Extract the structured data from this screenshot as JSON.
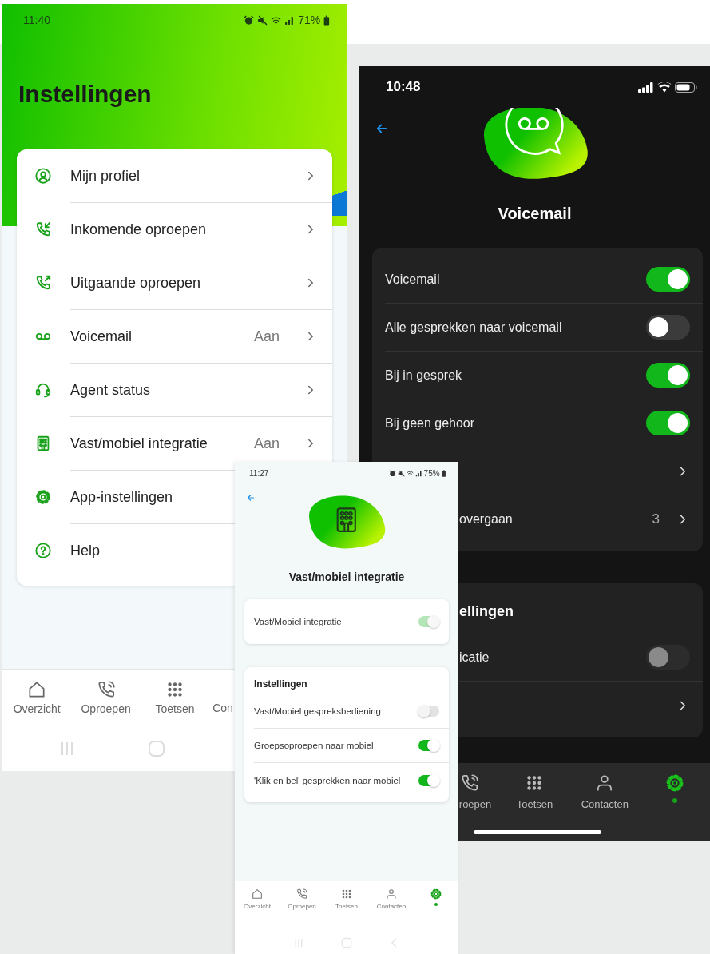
{
  "settings_screen": {
    "status_bar": {
      "time": "11:40",
      "battery": "71%"
    },
    "title": "Instellingen",
    "menu": [
      {
        "label": "Mijn profiel",
        "chevron": true
      },
      {
        "label": "Inkomende oproepen",
        "chevron": true
      },
      {
        "label": "Uitgaande oproepen",
        "chevron": true
      },
      {
        "label": "Voicemail",
        "value": "Aan",
        "chevron": true
      },
      {
        "label": "Agent status",
        "chevron": true
      },
      {
        "label": "Vast/mobiel integratie",
        "value": "Aan",
        "chevron": true
      },
      {
        "label": "App-instellingen",
        "chevron": false
      },
      {
        "label": "Help",
        "chevron": false
      }
    ],
    "nav": [
      {
        "label": "Overzicht",
        "selected": false
      },
      {
        "label": "Oproepen",
        "selected": false
      },
      {
        "label": "Toetsen",
        "selected": false
      },
      {
        "label": "Con",
        "selected": false
      }
    ]
  },
  "voicemail_screen": {
    "status_bar": {
      "time": "10:48"
    },
    "title": "Voicemail",
    "groups": [
      {
        "rows": [
          {
            "kind": "toggle",
            "label": "Voicemail",
            "on": true,
            "disabled": false
          },
          {
            "kind": "toggle",
            "label": "Alle gesprekken naar voicemail",
            "on": false,
            "disabled": false
          },
          {
            "kind": "toggle",
            "label": "Bij in gesprek",
            "on": true,
            "disabled": false
          },
          {
            "kind": "toggle",
            "label": "Bij geen gehoor",
            "on": true,
            "disabled": false
          },
          {
            "kind": "link"
          },
          {
            "kind": "link",
            "label": "overgaan",
            "value": "3"
          }
        ]
      },
      {
        "heading": "ellingen",
        "rows": [
          {
            "kind": "toggle",
            "label": "icatie",
            "on": false,
            "disabled": true
          },
          {
            "kind": "link"
          }
        ]
      }
    ],
    "nav": [
      {
        "label": "roepen",
        "selected": false
      },
      {
        "label": "Toetsen",
        "selected": false
      },
      {
        "label": "Contacten",
        "selected": false
      },
      {
        "selected": true
      }
    ]
  },
  "integration_screen": {
    "status_bar": {
      "time": "11:27",
      "battery": "75%"
    },
    "title": "Vast/mobiel integratie",
    "main_toggle": {
      "label": "Vast/Mobiel integratie",
      "on": true,
      "disabled": true
    },
    "settings": {
      "heading": "Instellingen",
      "rows": [
        {
          "label": "Vast/Mobiel gespreksbediening",
          "on": false
        },
        {
          "label": "Groepsoproepen naar mobiel",
          "on": true
        },
        {
          "label": "'Klik en bel' gesprekken naar mobiel",
          "on": true
        }
      ]
    },
    "nav": [
      {
        "label": "Overzicht",
        "selected": false
      },
      {
        "label": "Oproepen",
        "selected": false
      },
      {
        "label": "Toetsen",
        "selected": false
      },
      {
        "label": "Contacten",
        "selected": false
      },
      {
        "selected": true
      }
    ]
  }
}
